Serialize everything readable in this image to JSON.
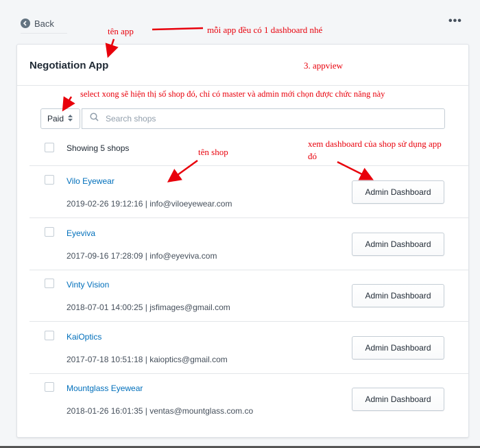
{
  "header": {
    "back_label": "Back",
    "more_label": "•••"
  },
  "app": {
    "title": "Negotiation App"
  },
  "filter": {
    "selected": "Paid",
    "caret": "⌃⌄"
  },
  "search": {
    "placeholder": "Search shops",
    "value": ""
  },
  "list": {
    "showing_text": "Showing 5 shops",
    "shops": [
      {
        "name": "Vilo Eyewear",
        "meta": "2019-02-26 19:12:16 | info@viloeyewear.com",
        "button": "Admin Dashboard"
      },
      {
        "name": "Eyeviva",
        "meta": "2017-09-16 17:28:09 | info@eyeviva.com",
        "button": "Admin Dashboard"
      },
      {
        "name": "Vinty Vision",
        "meta": "2018-07-01 14:00:25 | jsfimages@gmail.com",
        "button": "Admin Dashboard"
      },
      {
        "name": "KaiOptics",
        "meta": "2017-07-18 10:51:18 | kaioptics@gmail.com",
        "button": "Admin Dashboard"
      },
      {
        "name": "Mountglass Eyewear",
        "meta": "2018-01-26 16:01:35 | ventas@mountglass.com.co",
        "button": "Admin Dashboard"
      }
    ]
  },
  "annotations": {
    "app_name": "tên app",
    "one_dashboard": "mỗi app đều có 1 dashboard nhé",
    "appview": "3. appview",
    "select_note": "select xong sẽ hiện thị số shop đó, chỉ có master và admin mới chọn được chức năng này",
    "shop_name": "tên shop",
    "dashboard_note_1": "xem dashboard của shop sử dụng app",
    "dashboard_note_2": "đó"
  },
  "colors": {
    "annotation": "#e8000b",
    "link": "#006fbb",
    "accent_border": "#c4cdd5"
  },
  "icons": {
    "back": "chevron-left-circle-icon",
    "more": "horizontal-dots-icon",
    "search": "magnifier-icon",
    "select": "up-down-caret-icon"
  }
}
